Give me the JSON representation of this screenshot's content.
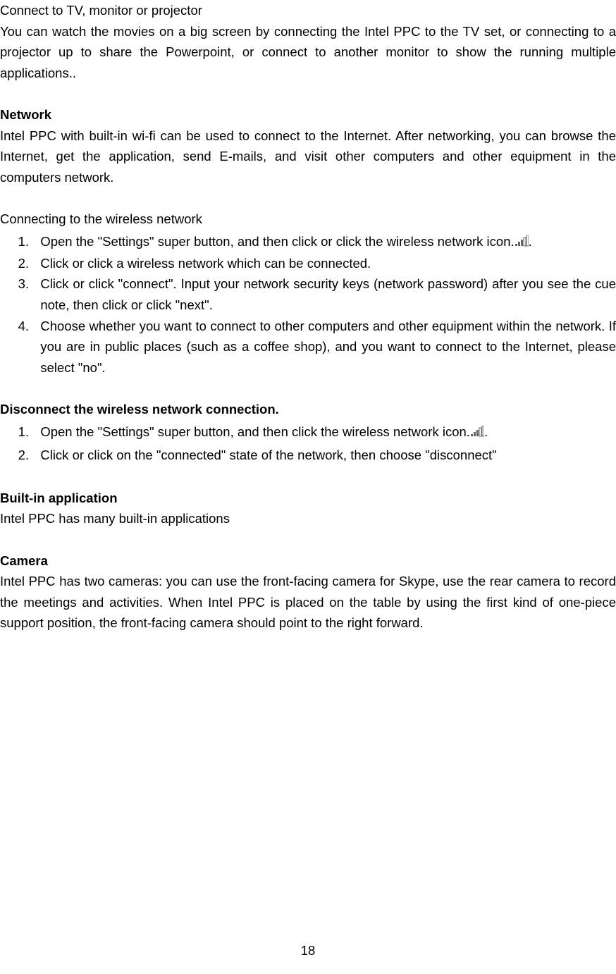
{
  "sections": {
    "connect_tv": {
      "heading": "Connect to TV, monitor or projector",
      "body": "You can watch the movies on a big screen by connecting the Intel PPC to the TV set, or connecting to a projector up to share the Powerpoint, or connect to another monitor to show the running multiple applications.."
    },
    "network": {
      "heading": "Network",
      "body": "Intel PPC with built-in wi-fi can be used to connect to the Internet. After networking, you can browse the Internet, get the application, send E-mails, and visit other computers and other equipment in the computers network."
    },
    "connecting": {
      "heading": "Connecting to the wireless network",
      "items": {
        "i1a": "Open the \"Settings\" super button, and then click or click the wireless network icon.",
        "i1b": ".",
        "i2": "Click or click a wireless network which can be connected.",
        "i3": "Click or click \"connect\". Input your network security keys (network password) after you see the cue note, then click or click \"next\".",
        "i4": "Choose whether you want to connect to other computers and other equipment within the network. If you are in public places (such as a coffee shop), and you want to connect to the Internet, please select \"no\"."
      }
    },
    "disconnect": {
      "heading": "Disconnect the wireless network connection.",
      "items": {
        "i1a": "Open the \"Settings\" super button, and then click the wireless network icon.",
        "i1b": ".",
        "i2": "Click or click on the \"connected\" state of the network, then choose \"disconnect\""
      }
    },
    "builtin": {
      "heading": "Built-in application",
      "body": "Intel PPC has many built-in applications"
    },
    "camera": {
      "heading": "Camera",
      "body": "Intel PPC has two cameras: you can use the front-facing camera for Skype, use the rear camera to record the meetings and activities. When Intel PPC is placed on the table by using the first kind of one-piece support position, the front-facing camera should point to the right forward."
    }
  },
  "page_number": "18"
}
